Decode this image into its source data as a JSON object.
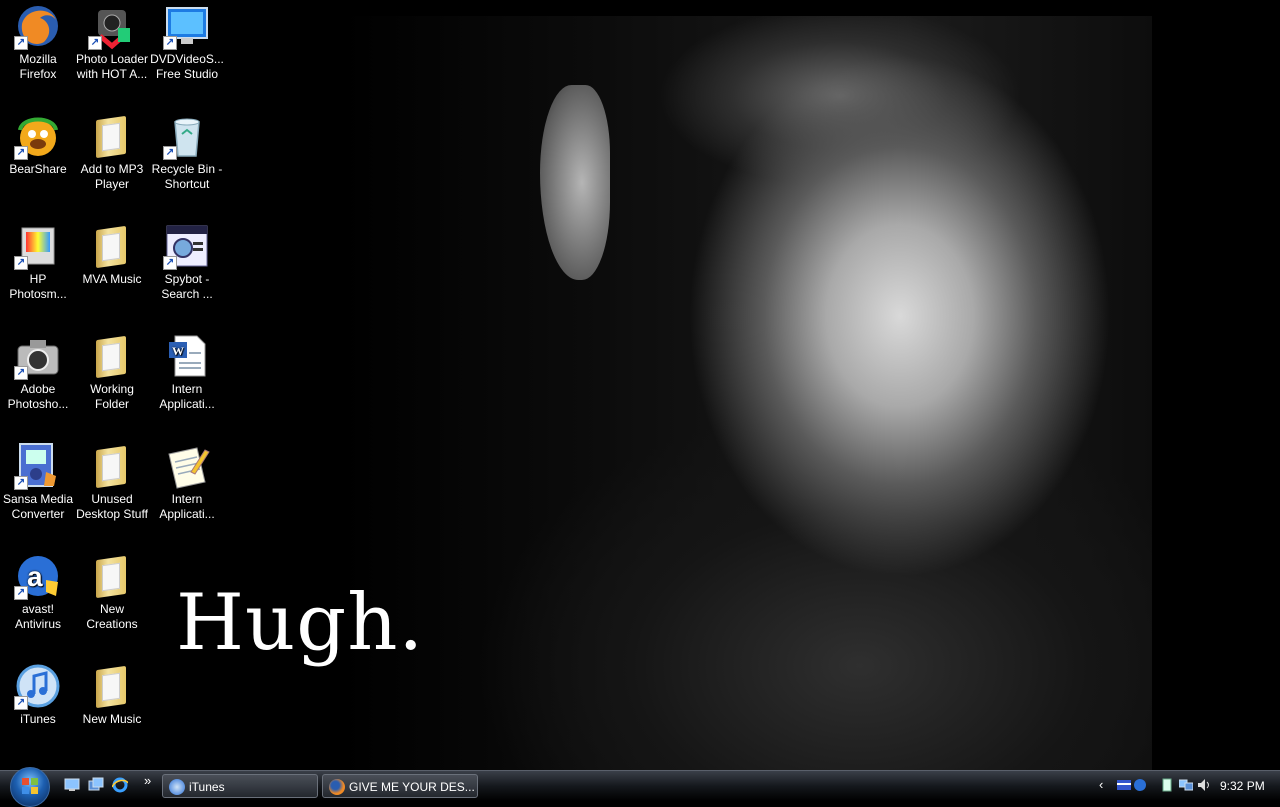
{
  "desktop": {
    "icons": [
      {
        "label": "Mozilla Firefox",
        "icon": "firefox-icon"
      },
      {
        "label": "Photo Loader with HOT A...",
        "icon": "photo-loader-icon"
      },
      {
        "label": "DVDVideoS... Free Studio",
        "icon": "dvd-video-studio-icon"
      },
      {
        "label": "BearShare",
        "icon": "bearshare-icon"
      },
      {
        "label": "Add to MP3 Player",
        "icon": "folder-icon"
      },
      {
        "label": "Recycle Bin - Shortcut",
        "icon": "recycle-bin-icon"
      },
      {
        "label": "HP Photosm...",
        "icon": "hp-photosmart-icon"
      },
      {
        "label": "MVA Music",
        "icon": "folder-icon"
      },
      {
        "label": "Spybot - Search ...",
        "icon": "spybot-icon"
      },
      {
        "label": "Adobe Photosho...",
        "icon": "camera-icon"
      },
      {
        "label": "Working Folder",
        "icon": "folder-icon"
      },
      {
        "label": "Intern Applicati...",
        "icon": "word-document-icon"
      },
      {
        "label": "Sansa Media Converter",
        "icon": "sansa-converter-icon"
      },
      {
        "label": "Unused Desktop Stuff",
        "icon": "folder-icon"
      },
      {
        "label": "Intern Applicati...",
        "icon": "notepad-pencil-icon"
      },
      {
        "label": "avast! Antivirus",
        "icon": "avast-icon"
      },
      {
        "label": "New Creations",
        "icon": "folder-icon"
      },
      {
        "label": "iTunes",
        "icon": "itunes-icon"
      },
      {
        "label": "New Music",
        "icon": "folder-icon"
      }
    ]
  },
  "wallpaper": {
    "caption": "Hugh."
  },
  "taskbar": {
    "tasks": [
      {
        "label": "iTunes",
        "icon": "itunes-icon"
      },
      {
        "label": "GIVE ME YOUR DES...",
        "icon": "firefox-icon"
      }
    ],
    "quick_launch_more": "»",
    "tray_expand": "‹",
    "clock": "9:32 PM"
  },
  "colors": {
    "taskbar": "#15181d",
    "folder": "#e6c86a"
  }
}
